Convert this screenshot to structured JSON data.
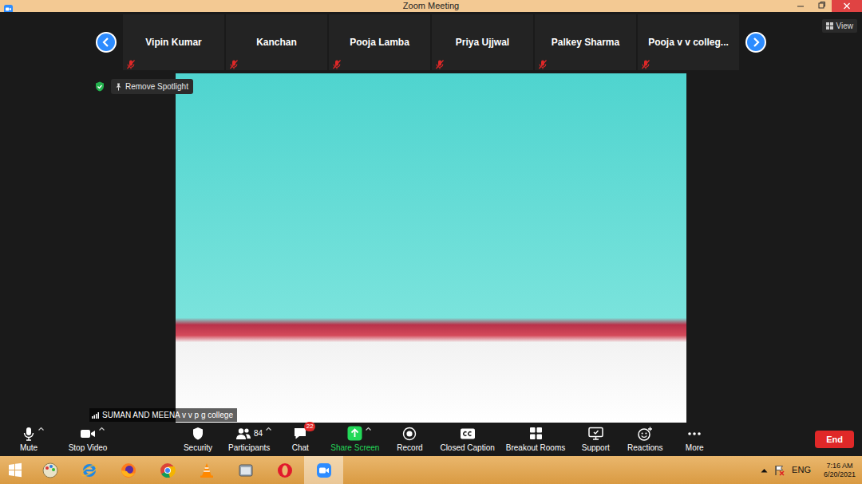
{
  "window": {
    "title": "Zoom Meeting"
  },
  "view_button": {
    "label": "View"
  },
  "participants": [
    {
      "name": "Vipin Kumar",
      "muted": true
    },
    {
      "name": "Kanchan",
      "muted": true
    },
    {
      "name": "Pooja Lamba",
      "muted": true
    },
    {
      "name": "Priya Ujjwal",
      "muted": true
    },
    {
      "name": "Palkey Sharma",
      "muted": true
    },
    {
      "name": "Pooja v v colleg...",
      "muted": true
    }
  ],
  "spotlight": {
    "label": "Remove Spotlight"
  },
  "video": {
    "name_label": "SUMAN AND MEENA v v p g college"
  },
  "toolbar": {
    "items": [
      {
        "label": "Mute",
        "menu": true,
        "color": "#ffffff"
      },
      {
        "label": "Stop Video",
        "menu": true,
        "color": "#ffffff"
      },
      {
        "label": "Security",
        "menu": false,
        "color": "#ffffff"
      },
      {
        "label": "Participants",
        "menu": true,
        "color": "#ffffff",
        "count": "84"
      },
      {
        "label": "Chat",
        "menu": false,
        "color": "#ffffff",
        "badge": "22"
      },
      {
        "label": "Share Screen",
        "menu": true,
        "color": "#23d959"
      },
      {
        "label": "Record",
        "menu": false,
        "color": "#ffffff"
      },
      {
        "label": "Closed Caption",
        "menu": false,
        "color": "#ffffff"
      },
      {
        "label": "Breakout Rooms",
        "menu": false,
        "color": "#ffffff"
      },
      {
        "label": "Support",
        "menu": false,
        "color": "#ffffff"
      },
      {
        "label": "Reactions",
        "menu": false,
        "color": "#ffffff"
      },
      {
        "label": "More",
        "menu": false,
        "color": "#ffffff"
      }
    ],
    "end_button": "End"
  },
  "taskbar": {
    "language": "ENG",
    "time": "7:16 AM",
    "date": "6/20/2021"
  }
}
